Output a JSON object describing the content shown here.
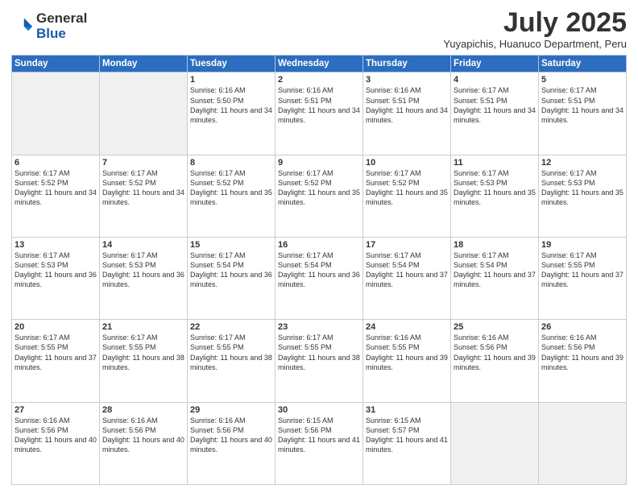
{
  "logo": {
    "general": "General",
    "blue": "Blue"
  },
  "title": "July 2025",
  "location": "Yuyapichis, Huanuco Department, Peru",
  "headers": [
    "Sunday",
    "Monday",
    "Tuesday",
    "Wednesday",
    "Thursday",
    "Friday",
    "Saturday"
  ],
  "weeks": [
    [
      {
        "day": "",
        "info": ""
      },
      {
        "day": "",
        "info": ""
      },
      {
        "day": "1",
        "info": "Sunrise: 6:16 AM\nSunset: 5:50 PM\nDaylight: 11 hours and 34 minutes."
      },
      {
        "day": "2",
        "info": "Sunrise: 6:16 AM\nSunset: 5:51 PM\nDaylight: 11 hours and 34 minutes."
      },
      {
        "day": "3",
        "info": "Sunrise: 6:16 AM\nSunset: 5:51 PM\nDaylight: 11 hours and 34 minutes."
      },
      {
        "day": "4",
        "info": "Sunrise: 6:17 AM\nSunset: 5:51 PM\nDaylight: 11 hours and 34 minutes."
      },
      {
        "day": "5",
        "info": "Sunrise: 6:17 AM\nSunset: 5:51 PM\nDaylight: 11 hours and 34 minutes."
      }
    ],
    [
      {
        "day": "6",
        "info": "Sunrise: 6:17 AM\nSunset: 5:52 PM\nDaylight: 11 hours and 34 minutes."
      },
      {
        "day": "7",
        "info": "Sunrise: 6:17 AM\nSunset: 5:52 PM\nDaylight: 11 hours and 34 minutes."
      },
      {
        "day": "8",
        "info": "Sunrise: 6:17 AM\nSunset: 5:52 PM\nDaylight: 11 hours and 35 minutes."
      },
      {
        "day": "9",
        "info": "Sunrise: 6:17 AM\nSunset: 5:52 PM\nDaylight: 11 hours and 35 minutes."
      },
      {
        "day": "10",
        "info": "Sunrise: 6:17 AM\nSunset: 5:52 PM\nDaylight: 11 hours and 35 minutes."
      },
      {
        "day": "11",
        "info": "Sunrise: 6:17 AM\nSunset: 5:53 PM\nDaylight: 11 hours and 35 minutes."
      },
      {
        "day": "12",
        "info": "Sunrise: 6:17 AM\nSunset: 5:53 PM\nDaylight: 11 hours and 35 minutes."
      }
    ],
    [
      {
        "day": "13",
        "info": "Sunrise: 6:17 AM\nSunset: 5:53 PM\nDaylight: 11 hours and 36 minutes."
      },
      {
        "day": "14",
        "info": "Sunrise: 6:17 AM\nSunset: 5:53 PM\nDaylight: 11 hours and 36 minutes."
      },
      {
        "day": "15",
        "info": "Sunrise: 6:17 AM\nSunset: 5:54 PM\nDaylight: 11 hours and 36 minutes."
      },
      {
        "day": "16",
        "info": "Sunrise: 6:17 AM\nSunset: 5:54 PM\nDaylight: 11 hours and 36 minutes."
      },
      {
        "day": "17",
        "info": "Sunrise: 6:17 AM\nSunset: 5:54 PM\nDaylight: 11 hours and 37 minutes."
      },
      {
        "day": "18",
        "info": "Sunrise: 6:17 AM\nSunset: 5:54 PM\nDaylight: 11 hours and 37 minutes."
      },
      {
        "day": "19",
        "info": "Sunrise: 6:17 AM\nSunset: 5:55 PM\nDaylight: 11 hours and 37 minutes."
      }
    ],
    [
      {
        "day": "20",
        "info": "Sunrise: 6:17 AM\nSunset: 5:55 PM\nDaylight: 11 hours and 37 minutes."
      },
      {
        "day": "21",
        "info": "Sunrise: 6:17 AM\nSunset: 5:55 PM\nDaylight: 11 hours and 38 minutes."
      },
      {
        "day": "22",
        "info": "Sunrise: 6:17 AM\nSunset: 5:55 PM\nDaylight: 11 hours and 38 minutes."
      },
      {
        "day": "23",
        "info": "Sunrise: 6:17 AM\nSunset: 5:55 PM\nDaylight: 11 hours and 38 minutes."
      },
      {
        "day": "24",
        "info": "Sunrise: 6:16 AM\nSunset: 5:55 PM\nDaylight: 11 hours and 39 minutes."
      },
      {
        "day": "25",
        "info": "Sunrise: 6:16 AM\nSunset: 5:56 PM\nDaylight: 11 hours and 39 minutes."
      },
      {
        "day": "26",
        "info": "Sunrise: 6:16 AM\nSunset: 5:56 PM\nDaylight: 11 hours and 39 minutes."
      }
    ],
    [
      {
        "day": "27",
        "info": "Sunrise: 6:16 AM\nSunset: 5:56 PM\nDaylight: 11 hours and 40 minutes."
      },
      {
        "day": "28",
        "info": "Sunrise: 6:16 AM\nSunset: 5:56 PM\nDaylight: 11 hours and 40 minutes."
      },
      {
        "day": "29",
        "info": "Sunrise: 6:16 AM\nSunset: 5:56 PM\nDaylight: 11 hours and 40 minutes."
      },
      {
        "day": "30",
        "info": "Sunrise: 6:15 AM\nSunset: 5:56 PM\nDaylight: 11 hours and 41 minutes."
      },
      {
        "day": "31",
        "info": "Sunrise: 6:15 AM\nSunset: 5:57 PM\nDaylight: 11 hours and 41 minutes."
      },
      {
        "day": "",
        "info": ""
      },
      {
        "day": "",
        "info": ""
      }
    ]
  ]
}
